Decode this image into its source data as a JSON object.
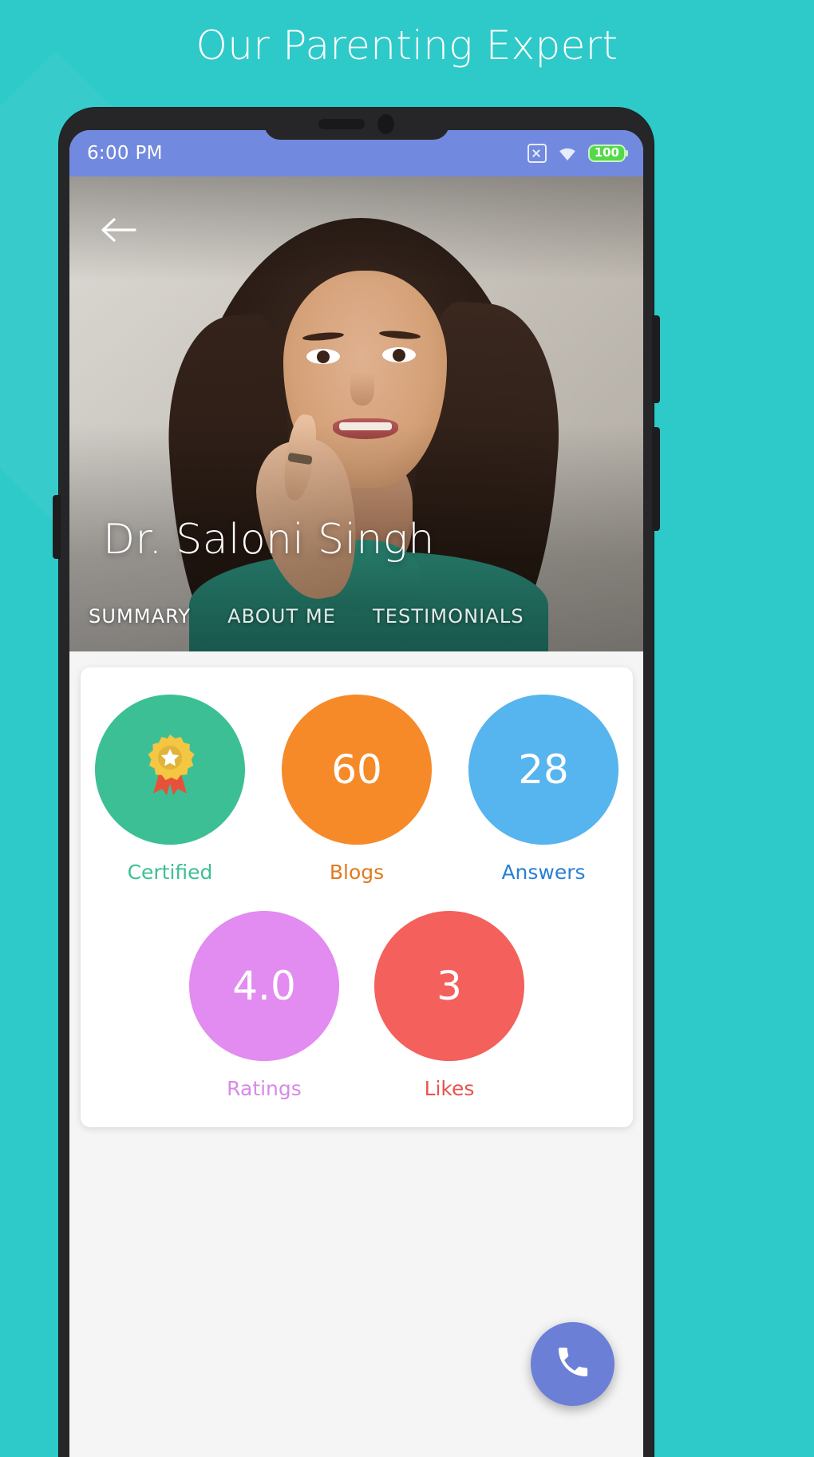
{
  "page": {
    "headline": "Our Parenting Expert",
    "background_color": "#2ec9c9"
  },
  "statusbar": {
    "time": "6:00 PM",
    "nosim_icon": "no-sim-icon",
    "wifi_icon": "wifi-icon",
    "battery_level": "100",
    "background_color": "#7289e0"
  },
  "hero": {
    "back_icon": "back-arrow-icon",
    "doctor_name": "Dr. Saloni Singh"
  },
  "tabs": [
    {
      "label": "SUMMARY",
      "active": true
    },
    {
      "label": "ABOUT ME",
      "active": false
    },
    {
      "label": "TESTIMONIALS",
      "active": false
    }
  ],
  "stats": {
    "row1": [
      {
        "value": "",
        "icon": "award-ribbon-icon",
        "label": "Certified",
        "color": "#3cbf94",
        "label_color": "#3cbf94"
      },
      {
        "value": "60",
        "icon": "",
        "label": "Blogs",
        "color": "#f68a28",
        "label_color": "#e07b20"
      },
      {
        "value": "28",
        "icon": "",
        "label": "Answers",
        "color": "#56b4ee",
        "label_color": "#2a7fd4"
      }
    ],
    "row2": [
      {
        "value": "4.0",
        "icon": "",
        "label": "Ratings",
        "color": "#e28bf0",
        "label_color": "#d88ae8"
      },
      {
        "value": "3",
        "icon": "",
        "label": "Likes",
        "color": "#f4605c",
        "label_color": "#e8534f"
      }
    ]
  },
  "fab": {
    "icon": "phone-call-icon",
    "color": "#6b7fd7"
  }
}
